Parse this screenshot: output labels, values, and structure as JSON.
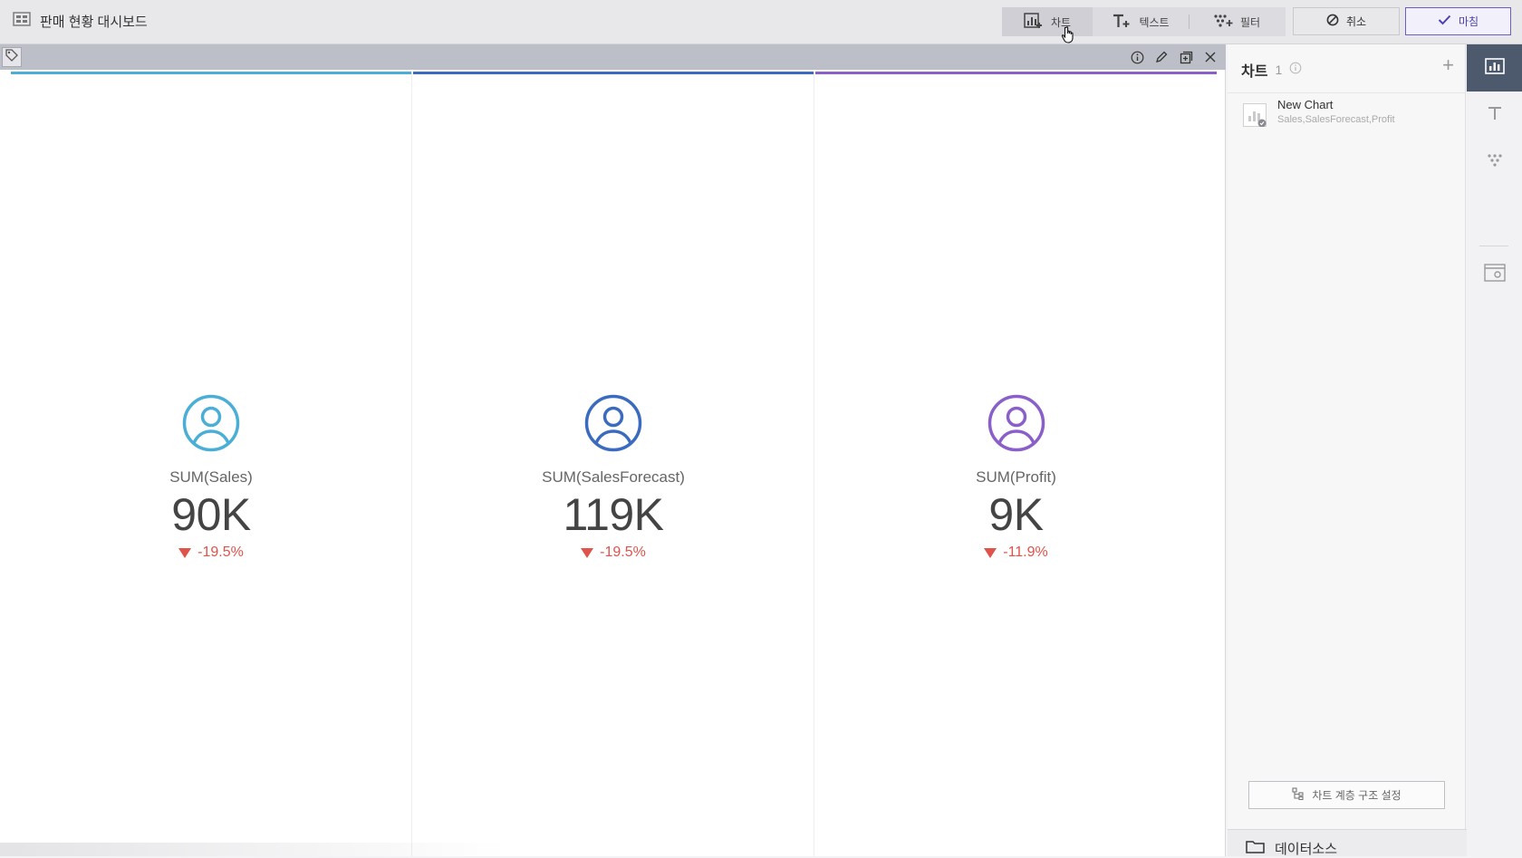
{
  "header": {
    "title": "판매 현황 대시보드",
    "tools": [
      {
        "label": "차트",
        "icon": "add-chart-icon"
      },
      {
        "label": "텍스트",
        "icon": "add-text-icon"
      },
      {
        "label": "필터",
        "icon": "filter-icon"
      }
    ],
    "cancel_label": "취소",
    "done_label": "마침"
  },
  "widget": {
    "kpis": [
      {
        "label": "SUM(Sales)",
        "value": "90K",
        "change": "-19.5%",
        "color": "#4aaed6"
      },
      {
        "label": "SUM(SalesForecast)",
        "value": "119K",
        "change": "-19.5%",
        "color": "#3b6bbf"
      },
      {
        "label": "SUM(Profit)",
        "value": "9K",
        "change": "-11.9%",
        "color": "#8a5fc9"
      }
    ],
    "change_color": "#e0534a"
  },
  "right_panel": {
    "title": "차트",
    "count": "1",
    "chart_item": {
      "name": "New Chart",
      "fields": "Sales,SalesForecast,Profit"
    },
    "hierarchy_button": "차트 계층 구조 설정",
    "datasource_label": "데이터소스"
  },
  "rail": [
    "chart-panel-icon",
    "text-panel-icon",
    "filter-panel-icon",
    "layout-panel-icon"
  ]
}
